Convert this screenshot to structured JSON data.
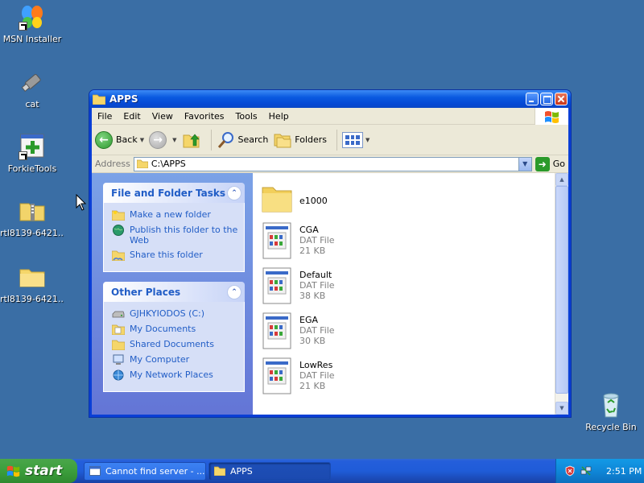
{
  "desktop": {
    "icons": [
      {
        "label": "MSN Installer",
        "icon": "msn-butterfly-icon"
      },
      {
        "label": "cat",
        "icon": "usb-drive-icon"
      },
      {
        "label": "ForkieTools",
        "icon": "tool-window-icon"
      },
      {
        "label": "rtl8139-6421...",
        "icon": "zip-folder-icon"
      },
      {
        "label": "rtl8139-6421...",
        "icon": "folder-icon"
      },
      {
        "label": "Recycle Bin",
        "icon": "recycle-bin-icon"
      }
    ]
  },
  "window": {
    "title": "APPS",
    "menu": [
      "File",
      "Edit",
      "View",
      "Favorites",
      "Tools",
      "Help"
    ],
    "toolbar": {
      "back_label": "Back",
      "search_label": "Search",
      "folders_label": "Folders"
    },
    "address": {
      "label": "Address",
      "value": "C:\\APPS",
      "go_label": "Go"
    },
    "taskpane": {
      "file_tasks": {
        "title": "File and Folder Tasks",
        "links": [
          "Make a new folder",
          "Publish this folder to the Web",
          "Share this folder"
        ]
      },
      "other_places": {
        "title": "Other Places",
        "links": [
          "GJHKYIODOS (C:)",
          "My Documents",
          "Shared Documents",
          "My Computer",
          "My Network Places"
        ]
      }
    },
    "files": [
      {
        "name": "e1000",
        "kind": "folder"
      },
      {
        "name": "CGA",
        "type": "DAT File",
        "size": "21 KB"
      },
      {
        "name": "Default",
        "type": "DAT File",
        "size": "38 KB"
      },
      {
        "name": "EGA",
        "type": "DAT File",
        "size": "30 KB"
      },
      {
        "name": "LowRes",
        "type": "DAT File",
        "size": "21 KB"
      }
    ]
  },
  "taskbar": {
    "start_label": "start",
    "tasks": [
      {
        "label": "Cannot find server - ...",
        "active": false
      },
      {
        "label": "APPS",
        "active": true
      }
    ],
    "clock": "2:51 PM"
  },
  "colors": {
    "desktop_bg": "#3a6ea5",
    "title_blue": "#0a5ae0",
    "taskpane_link": "#215dc6",
    "start_green": "#3c9e3c"
  }
}
